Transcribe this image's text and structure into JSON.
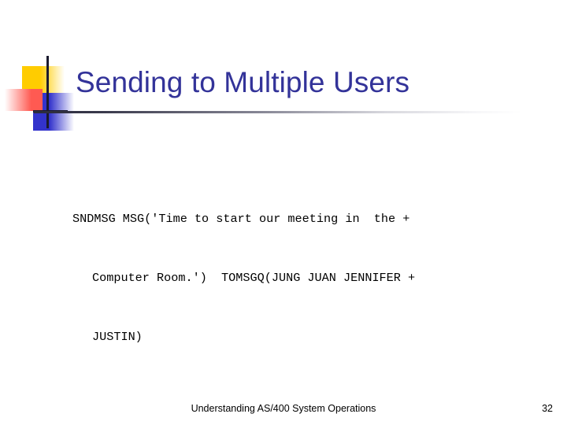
{
  "slide": {
    "title": "Sending to Multiple Users",
    "title_color": "#333399",
    "background_color": "#ffffff",
    "decoration": {
      "yellow_color": "#ffcc00",
      "blue_color": "#3333cc",
      "red_color": "#ff5a52",
      "crosshair_color": "#1a1a2e"
    },
    "body": {
      "lines": [
        "SNDMSG MSG('Time to start our meeting in  the +",
        "Computer Room.')  TOMSGQ(JUNG JUAN JENNIFER +",
        "JUSTIN)"
      ]
    },
    "footer": {
      "text": "Understanding AS/400 System Operations",
      "page_number": "32"
    }
  }
}
